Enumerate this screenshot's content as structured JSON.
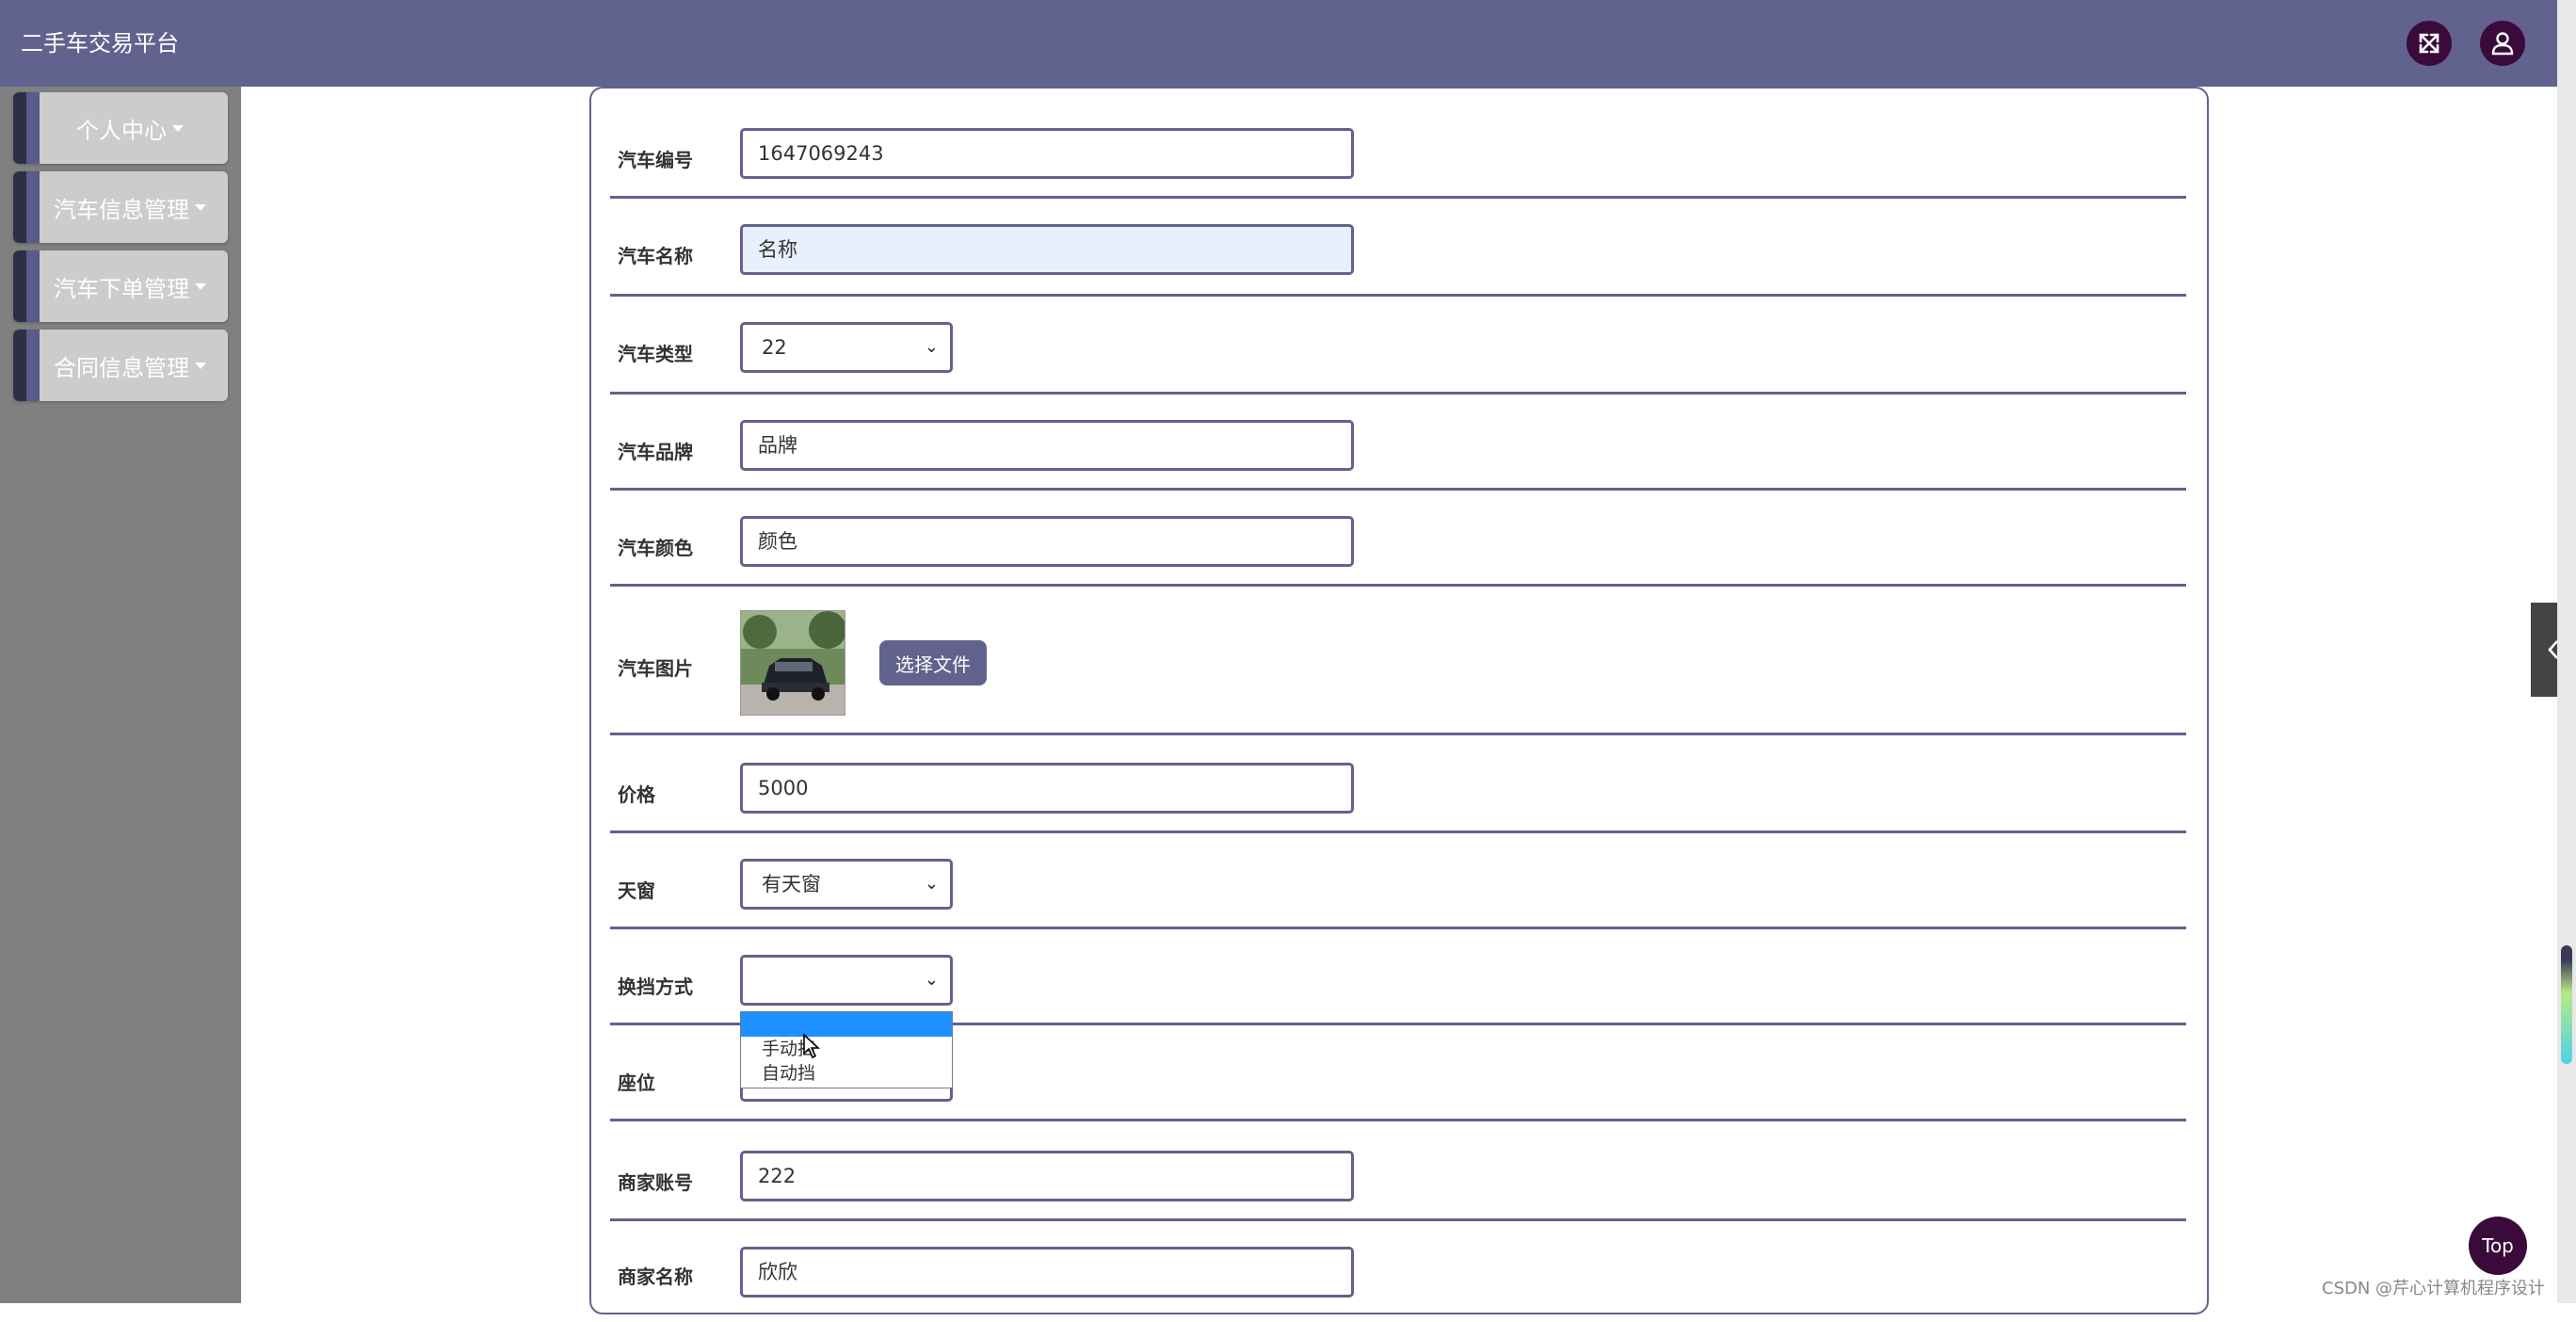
{
  "header": {
    "title": "二手车交易平台",
    "icons": [
      "fullscreen-icon",
      "user-icon"
    ],
    "bg_color": "#62628f"
  },
  "sidebar": {
    "items": [
      {
        "label": "个人中心"
      },
      {
        "label": "汽车信息管理"
      },
      {
        "label": "汽车下单管理"
      },
      {
        "label": "合同信息管理"
      }
    ]
  },
  "form": {
    "car_id": {
      "label": "汽车编号",
      "value": "1647069243"
    },
    "car_name": {
      "label": "汽车名称",
      "value": "名称"
    },
    "car_type": {
      "label": "汽车类型",
      "value": "22"
    },
    "brand": {
      "label": "汽车品牌",
      "value": "品牌"
    },
    "color": {
      "label": "汽车颜色",
      "value": "颜色"
    },
    "image": {
      "label": "汽车图片",
      "button": "选择文件"
    },
    "price": {
      "label": "价格",
      "value": "5000"
    },
    "sunroof": {
      "label": "天窗",
      "value": "有天窗"
    },
    "transmission": {
      "label": "换挡方式",
      "value": "",
      "options": [
        "",
        "手动挡",
        "自动挡"
      ]
    },
    "seats": {
      "label": "座位",
      "value": ""
    },
    "merchant_account": {
      "label": "商家账号",
      "value": "222"
    },
    "merchant_name": {
      "label": "商家名称",
      "value": "欣欣"
    }
  },
  "top_button": "Top",
  "watermark": "CSDN @芹心计算机程序设计"
}
